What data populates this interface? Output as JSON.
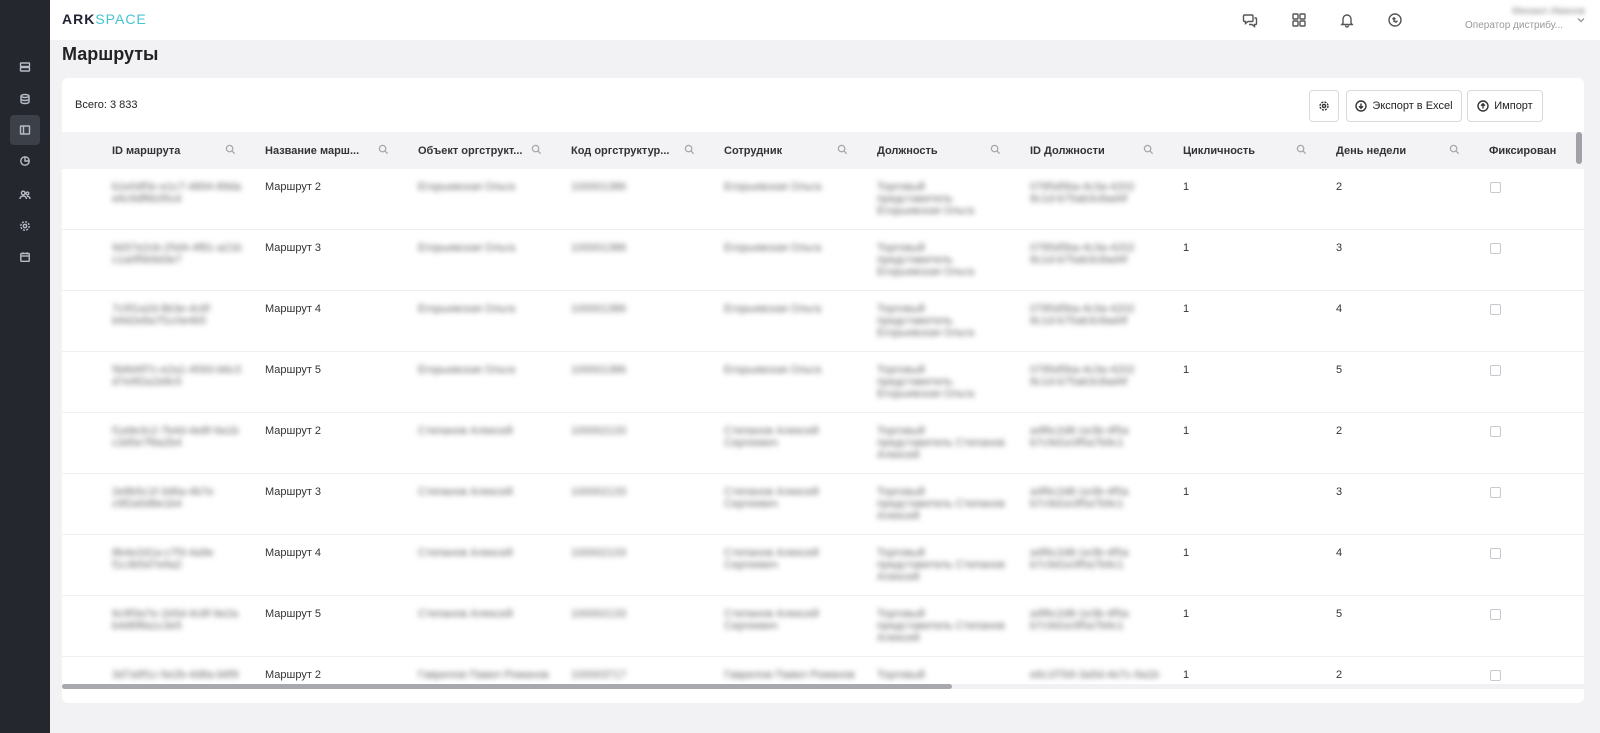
{
  "brand": {
    "ark": "ARK",
    "space": "SPACE"
  },
  "user": {
    "name": "Михаил Иванов",
    "role": "Оператор дистрибу..."
  },
  "page": {
    "title": "Маршруты"
  },
  "toolbar": {
    "total": "Всего: 3 833",
    "export_label": "Экспорт в Excel",
    "import_label": "Импорт"
  },
  "sidebar": {
    "items": [
      "storage-icon",
      "database-icon",
      "routes-icon",
      "chart-icon",
      "users-icon",
      "settings-icon",
      "calendar-icon"
    ]
  },
  "columns": [
    "ID маршрута",
    "Название марш...",
    "Объект оргструкт...",
    "Код оргструктур...",
    "Сотрудник",
    "Должность",
    "ID Должности",
    "Цикличность",
    "День недели",
    "Фиксирован"
  ],
  "rows": [
    {
      "id": "b1e0df3c-e1c7-4894-89da\ne6c9df6b35cd",
      "name": "Маршрут 2",
      "org": "Егорьевская Ольга",
      "code": "100001386",
      "emp": "Егорьевская Ольга",
      "pos": "Торговый\nпредставитель\nЕгорьевская Ольга",
      "pos_id": "0785d5ba-4c3a-4202\n8c1d-b75ab3c8ad4f",
      "cycle": "1",
      "day": "2"
    },
    {
      "id": "9d37e2cb-25d4-4f81-a21b\nc1a0f5b9d3e7",
      "name": "Маршрут 3",
      "org": "Егорьевская Ольга",
      "code": "100001386",
      "emp": "Егорьевская Ольга",
      "pos": "Торговый\nпредставитель\nЕгорьевская Ольга",
      "pos_id": "0785d5ba-4c3a-4202\n8c1d-b75ab3c8ad4f",
      "cycle": "1",
      "day": "3"
    },
    {
      "id": "7c5f1a2d-8b3e-4c6f\nb9d2e8a7f1c0e4b5",
      "name": "Маршрут 4",
      "org": "Егорьевская Ольга",
      "code": "100001386",
      "emp": "Егорьевская Ольга",
      "pos": "Торговый\nпредставитель\nЕгорьевская Ольга",
      "pos_id": "0785d5ba-4c3a-4202\n8c1d-b75ab3c8ad4f",
      "cycle": "1",
      "day": "4"
    },
    {
      "id": "5b8d4f7c-e2a1-4593-b6c3\nd7e9f2a1b8c5",
      "name": "Маршрут 5",
      "org": "Егорьевская Ольга",
      "code": "100001386",
      "emp": "Егорьевская Ольга",
      "pos": "Торговый\nпредставитель\nЕгорьевская Ольга",
      "pos_id": "0785d5ba-4c3a-4202\n8c1d-b75ab3c8ad4f",
      "cycle": "1",
      "day": "5"
    },
    {
      "id": "f1a9e3c2-7b4d-4e8f-9a1b\nc3d5e7f9a2b4",
      "name": "Маршрут 2",
      "org": "Степанов Алексей",
      "code": "100002133",
      "emp": "Степанов Алексей\nСергеевич",
      "pos": "Торговый\nпредставитель Степанов\nАлексей",
      "pos_id": "a4f6c2d8-1e3b-4f5a\nb7c9d1e3f5a7b9c1",
      "cycle": "1",
      "day": "2"
    },
    {
      "id": "2e8b5c1f-3d6a-4b7e\nc9f2a5d8e1b4",
      "name": "Маршрут 3",
      "org": "Степанов Алексей",
      "code": "100002133",
      "emp": "Степанов Алексей\nСергеевич",
      "pos": "Торговый\nпредставитель Степанов\nАлексей",
      "pos_id": "a4f6c2d8-1e3b-4f5a\nb7c9d1e3f5a7b9c1",
      "cycle": "1",
      "day": "3"
    },
    {
      "id": "8b4e2d1a-c7f3-4a9e\nf1c3b5d7e9a2",
      "name": "Маршрут 4",
      "org": "Степанов Алексей",
      "code": "100002133",
      "emp": "Степанов Алексей\nСергеевич",
      "pos": "Торговый\nпредставитель Степанов\nАлексей",
      "pos_id": "a4f6c2d8-1e3b-4f5a\nb7c9d1e3f5a7b9c1",
      "cycle": "1",
      "day": "4"
    },
    {
      "id": "6c9f3a7e-1b5d-4c8f-9e2a\nb4d6f8a1c3e5",
      "name": "Маршрут 5",
      "org": "Степанов Алексей",
      "code": "100002133",
      "emp": "Степанов Алексей\nСергеевич",
      "pos": "Торговый\nпредставитель Степанов\nАлексей",
      "pos_id": "a4f6c2d8-1e3b-4f5a\nb7c9d1e3f5a7b9c1",
      "cycle": "1",
      "day": "5"
    },
    {
      "id": "3d7a9f1c-5e2b-4d8a-b6f9",
      "name": "Маршрут 2",
      "org": "Гаврилов Павел Романов",
      "code": "100003717",
      "emp": "Гаврилов Павел Романов",
      "pos": "Торговый",
      "pos_id": "e6c1f7b9-3a5d-4e7c-9a1b",
      "cycle": "1",
      "day": "2"
    }
  ]
}
